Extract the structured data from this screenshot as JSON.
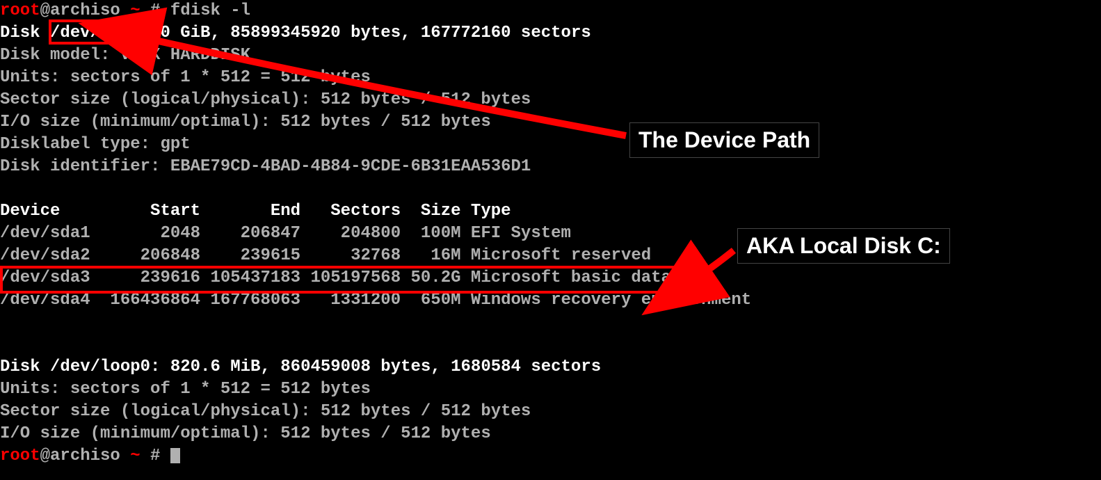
{
  "prompt1": {
    "user": "root",
    "host": "@archiso ",
    "tilde": "~",
    "hash": " # ",
    "command": "fdisk -l"
  },
  "disk1": {
    "prefix": "Disk ",
    "path": "/dev/sda",
    "rest": ": 80 GiB, 85899345920 bytes, 167772160 sectors",
    "model": "Disk model: VBOX HARDDISK",
    "units": "Units: sectors of 1 * 512 = 512 bytes",
    "sector": "Sector size (logical/physical): 512 bytes / 512 bytes",
    "io": "I/O size (minimum/optimal): 512 bytes / 512 bytes",
    "labeltype": "Disklabel type: gpt",
    "identifier": "Disk identifier: EBAE79CD-4BAD-4B84-9CDE-6B31EAA536D1"
  },
  "table": {
    "header": "Device        Start       End   Sectors  Size Type",
    "rows": [
      {
        "dev": "/dev/sda1",
        "start": "2048",
        "end": "206847",
        "sectors": "204800",
        "size": "100M",
        "type": "EFI System"
      },
      {
        "dev": "/dev/sda2",
        "start": "206848",
        "end": "239615",
        "sectors": "32768",
        "size": "16M",
        "type": "Microsoft reserved"
      },
      {
        "dev": "/dev/sda3",
        "start": "239616",
        "end": "105437183",
        "sectors": "105197568",
        "size": "50.2G",
        "type": "Microsoft basic data"
      },
      {
        "dev": "/dev/sda4",
        "start": "166436864",
        "end": "167768063",
        "sectors": "1331200",
        "size": "650M",
        "type": "Windows recovery environment"
      }
    ]
  },
  "disk2": {
    "header": "Disk /dev/loop0: 820.6 MiB, 860459008 bytes, 1680584 sectors",
    "units": "Units: sectors of 1 * 512 = 512 bytes",
    "sector": "Sector size (logical/physical): 512 bytes / 512 bytes",
    "io": "I/O size (minimum/optimal): 512 bytes / 512 bytes"
  },
  "prompt2": {
    "user": "root",
    "host": "@archiso ",
    "tilde": "~",
    "hash": " # "
  },
  "annotations": {
    "a1": "The Device Path",
    "a2": "AKA Local Disk C:"
  }
}
